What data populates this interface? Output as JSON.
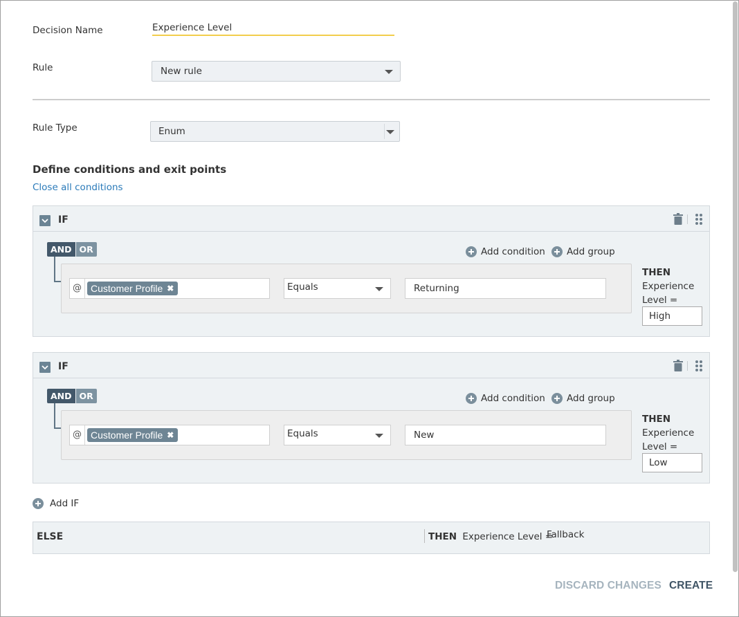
{
  "form": {
    "decision_name_label": "Decision Name",
    "decision_name_value": "Experience Level",
    "rule_label": "Rule",
    "rule_value": "New rule",
    "rule_type_label": "Rule Type",
    "rule_type_value": "Enum"
  },
  "conditions": {
    "title": "Define conditions and exit points",
    "close_all_link": "Close all conditions",
    "if_label": "IF",
    "and_label": "AND",
    "or_label": "OR",
    "add_condition_label": "Add condition",
    "add_group_label": "Add group",
    "then_word": "THEN",
    "then_text": "Experience Level =",
    "blocks": [
      {
        "field_chip": "Customer Profile",
        "operator": "Equals",
        "value": "Returning",
        "then_value": "High"
      },
      {
        "field_chip": "Customer Profile",
        "operator": "Equals",
        "value": "New",
        "then_value": "Low"
      }
    ],
    "add_if_label": "Add IF",
    "else": {
      "label": "ELSE",
      "then_word": "THEN",
      "then_text": "Experience Level =",
      "value": "Fallback"
    }
  },
  "footer": {
    "discard_label": "DISCARD CHANGES",
    "create_label": "CREATE"
  },
  "icons": {
    "at": "@",
    "chip_remove": "✖"
  },
  "colors": {
    "accent_underline": "#f2cd4c",
    "link": "#2a7ab9",
    "and_active": "#43586a",
    "or_inactive": "#7d93a1"
  }
}
